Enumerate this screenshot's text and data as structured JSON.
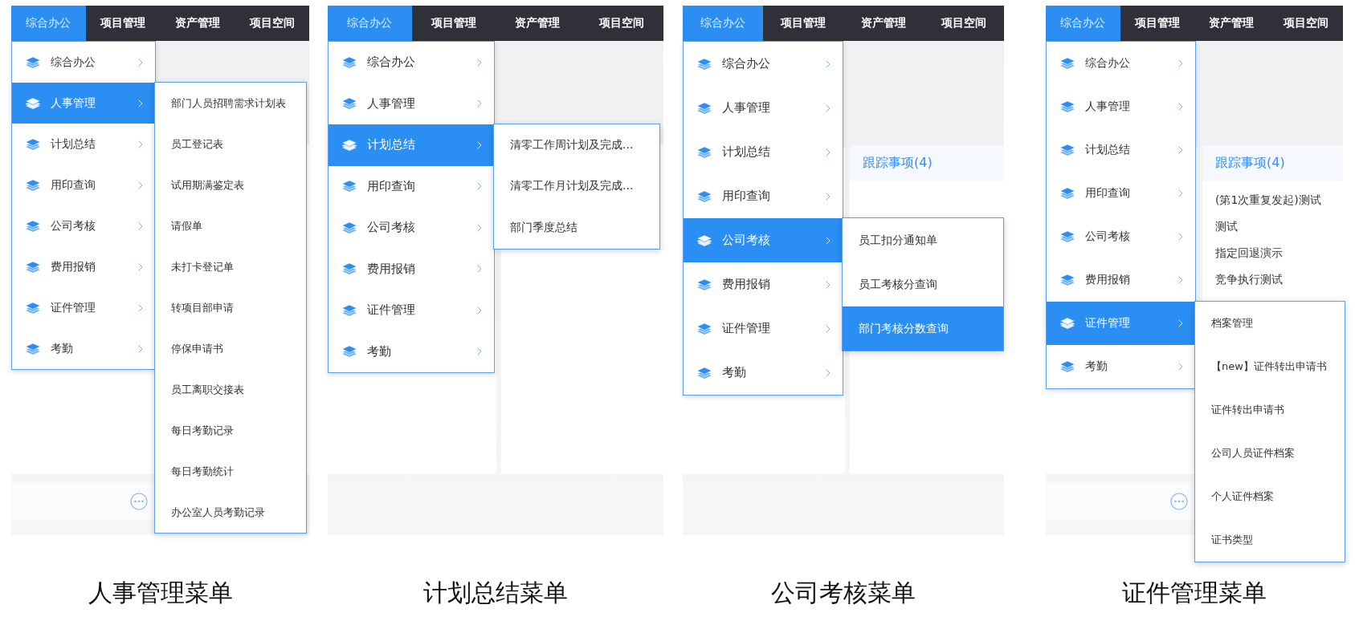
{
  "panels": [
    {
      "top_nav": [
        {
          "label": "综合办公",
          "selected": true
        },
        {
          "label": "项目管理",
          "selected": false
        },
        {
          "label": "资产管理",
          "selected": false
        },
        {
          "label": "项目空间",
          "selected": false
        }
      ],
      "menu": [
        {
          "label": "综合办公",
          "selected": false
        },
        {
          "label": "人事管理",
          "selected": true
        },
        {
          "label": "计划总结",
          "selected": false
        },
        {
          "label": "用印查询",
          "selected": false
        },
        {
          "label": "公司考核",
          "selected": false
        },
        {
          "label": "费用报销",
          "selected": false
        },
        {
          "label": "证件管理",
          "selected": false
        },
        {
          "label": "考勤",
          "selected": false
        }
      ],
      "submenu": [
        {
          "label": "部门人员招聘需求计划表",
          "selected": false
        },
        {
          "label": "员工登记表",
          "selected": false
        },
        {
          "label": "试用期满鉴定表",
          "selected": false
        },
        {
          "label": "请假单",
          "selected": false
        },
        {
          "label": "未打卡登记单",
          "selected": false
        },
        {
          "label": "转项目部申请",
          "selected": false
        },
        {
          "label": "停保申请书",
          "selected": false
        },
        {
          "label": "员工离职交接表",
          "selected": false
        },
        {
          "label": "每日考勤记录",
          "selected": false
        },
        {
          "label": "每日考勤统计",
          "selected": false
        },
        {
          "label": "办公室人员考勤记录",
          "selected": false
        }
      ],
      "more_card": true,
      "caption": "人事管理菜单"
    },
    {
      "top_nav": [
        {
          "label": "综合办公",
          "selected": true
        },
        {
          "label": "项目管理",
          "selected": false
        },
        {
          "label": "资产管理",
          "selected": false
        },
        {
          "label": "项目空间",
          "selected": false
        }
      ],
      "menu": [
        {
          "label": "综合办公",
          "selected": false
        },
        {
          "label": "人事管理",
          "selected": false
        },
        {
          "label": "计划总结",
          "selected": true
        },
        {
          "label": "用印查询",
          "selected": false
        },
        {
          "label": "公司考核",
          "selected": false
        },
        {
          "label": "费用报销",
          "selected": false
        },
        {
          "label": "证件管理",
          "selected": false
        },
        {
          "label": "考勤",
          "selected": false
        }
      ],
      "submenu": [
        {
          "label": "清零工作周计划及完成...",
          "selected": false
        },
        {
          "label": "清零工作月计划及完成...",
          "selected": false
        },
        {
          "label": "部门季度总结",
          "selected": false
        }
      ],
      "more_card": false,
      "caption": "计划总结菜单"
    },
    {
      "top_nav": [
        {
          "label": "综合办公",
          "selected": true
        },
        {
          "label": "项目管理",
          "selected": false
        },
        {
          "label": "资产管理",
          "selected": false
        },
        {
          "label": "项目空间",
          "selected": false
        }
      ],
      "menu": [
        {
          "label": "综合办公",
          "selected": false
        },
        {
          "label": "人事管理",
          "selected": false
        },
        {
          "label": "计划总结",
          "selected": false
        },
        {
          "label": "用印查询",
          "selected": false
        },
        {
          "label": "公司考核",
          "selected": true
        },
        {
          "label": "费用报销",
          "selected": false
        },
        {
          "label": "证件管理",
          "selected": false
        },
        {
          "label": "考勤",
          "selected": false
        }
      ],
      "submenu": [
        {
          "label": "员工扣分通知单",
          "selected": false
        },
        {
          "label": "员工考核分查询",
          "selected": false
        },
        {
          "label": "部门考核分数查询",
          "selected": true
        }
      ],
      "card": {
        "title": "跟踪事项(4)"
      },
      "more_card": false,
      "caption": "公司考核菜单"
    },
    {
      "top_nav": [
        {
          "label": "综合办公",
          "selected": true
        },
        {
          "label": "项目管理",
          "selected": false
        },
        {
          "label": "资产管理",
          "selected": false
        },
        {
          "label": "项目空间",
          "selected": false
        }
      ],
      "menu": [
        {
          "label": "综合办公",
          "selected": false
        },
        {
          "label": "人事管理",
          "selected": false
        },
        {
          "label": "计划总结",
          "selected": false
        },
        {
          "label": "用印查询",
          "selected": false
        },
        {
          "label": "公司考核",
          "selected": false
        },
        {
          "label": "费用报销",
          "selected": false
        },
        {
          "label": "证件管理",
          "selected": true
        },
        {
          "label": "考勤",
          "selected": false
        }
      ],
      "submenu": [
        {
          "label": "档案管理",
          "selected": false
        },
        {
          "label": "【new】证件转出申请书",
          "selected": false
        },
        {
          "label": "证件转出申请书",
          "selected": false
        },
        {
          "label": "公司人员证件档案",
          "selected": false
        },
        {
          "label": "个人证件档案",
          "selected": false
        },
        {
          "label": "证书类型",
          "selected": false
        }
      ],
      "card": {
        "title": "跟踪事项(4)",
        "items": [
          "(第1次重复发起)测试",
          "测试",
          "指定回退演示",
          "竞争执行测试"
        ]
      },
      "more_card": true,
      "caption": "证件管理菜单"
    }
  ]
}
